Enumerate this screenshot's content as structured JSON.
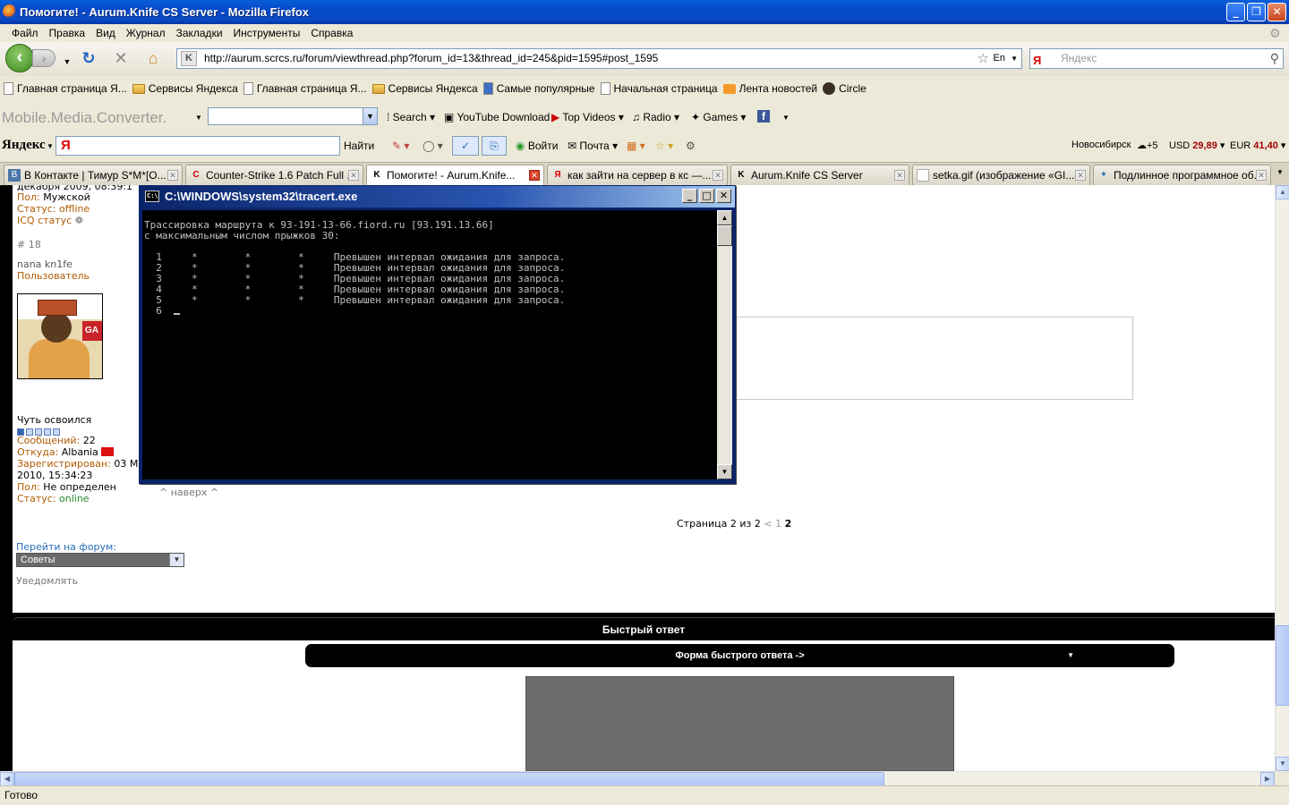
{
  "window": {
    "title": "Помогите! - Aurum.Knife CS Server - Mozilla Firefox",
    "controls": {
      "minimize": "_",
      "restore": "❐",
      "close": "✕"
    }
  },
  "menu": [
    "Файл",
    "Правка",
    "Вид",
    "Журнал",
    "Закладки",
    "Инструменты",
    "Справка"
  ],
  "nav": {
    "url": "http://aurum.scrcs.ru/forum/viewthread.php?forum_id=13&thread_id=245&pid=1595#post_1595",
    "site_icon": "K",
    "lang": "En",
    "search_placeholder": "Яндекс",
    "search_engine": "Я"
  },
  "bookmarks": [
    {
      "label": "Главная страница Я...",
      "icon": "page"
    },
    {
      "label": "Сервисы Яндекса",
      "icon": "folder"
    },
    {
      "label": "Главная страница Я...",
      "icon": "page"
    },
    {
      "label": "Сервисы Яндекса",
      "icon": "folder"
    },
    {
      "label": "Самые популярные",
      "icon": "page"
    },
    {
      "label": "Начальная страница",
      "icon": "page"
    },
    {
      "label": "Лента новостей",
      "icon": "rss"
    },
    {
      "label": "Circle",
      "icon": "circle"
    }
  ],
  "mmc_toolbar": {
    "brand": "Mobile.Media.Converter.",
    "search": "Search",
    "youtube": "YouTube Download",
    "topvideos": "Top Videos",
    "radio": "Radio",
    "games": "Games"
  },
  "yandex_bar": {
    "logo": "Яндекс",
    "input_logo": "Я",
    "find": "Найти",
    "login": "Войти",
    "mail": "Почта",
    "city": "Новосибирск",
    "temp": "+5",
    "usd_label": "USD",
    "usd_value": "29,89",
    "eur_label": "EUR",
    "eur_value": "41,40"
  },
  "tabs": [
    {
      "label": "В Контакте | Тимур S*M*[O...",
      "icon": "В",
      "active": false
    },
    {
      "label": "Counter-Strike 1.6 Patch Full ...",
      "icon": "C",
      "active": false
    },
    {
      "label": "Помогите! - Aurum.Knife...",
      "icon": "K",
      "active": true
    },
    {
      "label": "как зайти на сервер в кс —...",
      "icon": "Я",
      "active": false
    },
    {
      "label": "Aurum.Knife CS Server",
      "icon": "K",
      "active": false
    },
    {
      "label": "setka.gif (изображение «GI...",
      "icon": "",
      "active": false
    },
    {
      "label": "Подлинное программное об...",
      "icon": "✦",
      "active": false
    }
  ],
  "forum": {
    "user1": {
      "reg_partial": "декабря 2009, 08:39:1",
      "gender_label": "Пол:",
      "gender": "Мужской",
      "status_label": "Статус:",
      "status": "offline",
      "icq_label": "ICQ статус"
    },
    "post_number": "# 18",
    "user2": {
      "name": "nana kn1fe",
      "role": "Пользователь",
      "avatar_sign": "GA",
      "rank": "Чуть освоился",
      "rank_level": 1,
      "rank_max": 5,
      "posts_label": "Сообщений:",
      "posts": "22",
      "from_label": "Откуда:",
      "from": "Albania",
      "reg_label": "Зарегистрирован:",
      "reg_date": "03 M",
      "reg_time": "2010, 15:34:23",
      "gender_label": "Пол:",
      "gender": "Не определен",
      "status_label": "Статус:",
      "status": "online"
    },
    "to_top": "^ наверх ^",
    "pager": {
      "text": "Страница 2 из 2",
      "prev": "<",
      "p1": "1",
      "p2": "2"
    },
    "goto_label": "Перейти на форум:",
    "goto_value": "Советы",
    "notify": "Уведомлять",
    "quick_reply": "Быстрый ответ",
    "quick_form": "Форма быстрого ответа ->"
  },
  "console": {
    "title": "C:\\WINDOWS\\system32\\tracert.exe",
    "icon_text": "C:\\",
    "line1": "Трассировка маршрута к 93-191-13-66.fiord.ru [93.191.13.66]",
    "line2": "с максимальным числом прыжков 30:",
    "hops": [
      "  1     *        *        *     Превышен интервал ожидания для запроса.",
      "  2     *        *        *     Превышен интервал ожидания для запроса.",
      "  3     *        *        *     Превышен интервал ожидания для запроса.",
      "  4     *        *        *     Превышен интервал ожидания для запроса.",
      "  5     *        *        *     Превышен интервал ожидания для запроса."
    ],
    "current": "  6  "
  },
  "status": "Готово"
}
